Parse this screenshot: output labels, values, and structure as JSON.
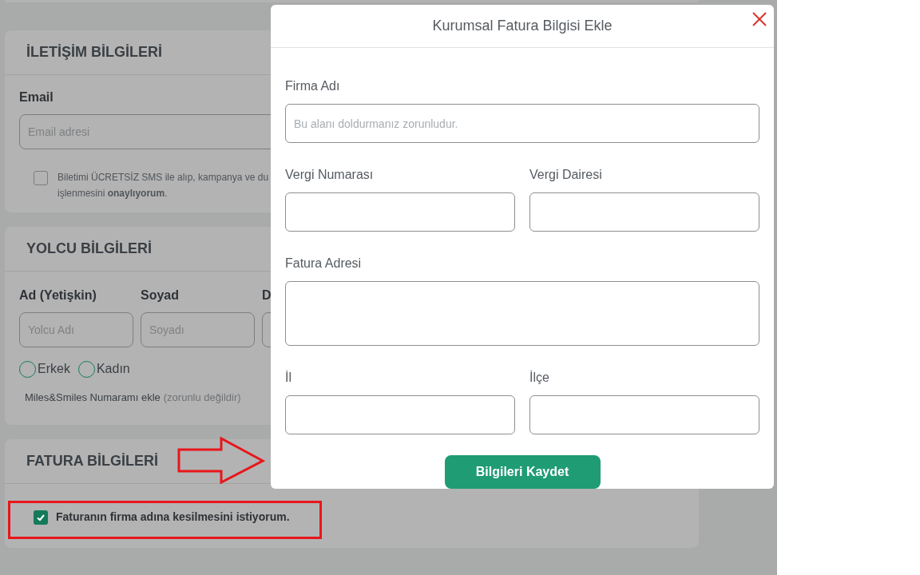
{
  "contact": {
    "title": "İLETİŞİM BİLGİLERİ",
    "email_label": "Email",
    "email_placeholder": "Email adresi",
    "sms_consent": {
      "checked": false,
      "line_1": "Biletimi ÜCRETSİZ SMS ile alıp, kampanya ve du",
      "line_2": "işlenmesini **onaylıyorum**."
    }
  },
  "passenger": {
    "title": "YOLCU BİLGİLERİ",
    "fields": [
      {
        "label": "Ad (Yetişkin)",
        "placeholder": "Yolcu Adı"
      },
      {
        "label": "Soyad",
        "placeholder": "Soyadı"
      },
      {
        "label": "D"
      }
    ],
    "genders": [
      {
        "label": "Erkek",
        "selected": false
      },
      {
        "label": "Kadın",
        "selected": false
      }
    ],
    "miles_link": "Miles&Smiles Numaramı ekle",
    "miles_note": "(zorunlu değildir)"
  },
  "invoice": {
    "title": "FATURA BİLGİLERİ",
    "corporate": {
      "checked": true,
      "label": "Faturanın firma adına kesilmesini istiyorum."
    }
  },
  "modal": {
    "title": "Kurumsal Fatura Bilgisi Ekle",
    "rows": [
      [
        {
          "label": "Firma Adı",
          "placeholder": "Bu alanı doldurmanız zorunludur.",
          "kind": "input"
        }
      ],
      [
        {
          "label": "Vergi Numarası",
          "kind": "input"
        },
        {
          "label": "Vergi Dairesi",
          "kind": "input"
        }
      ],
      [
        {
          "label": "Fatura Adresi",
          "kind": "textarea"
        }
      ],
      [
        {
          "label": "İl",
          "kind": "input"
        },
        {
          "label": "İlçe",
          "kind": "input"
        }
      ]
    ],
    "save_button": "Bilgileri Kaydet"
  }
}
